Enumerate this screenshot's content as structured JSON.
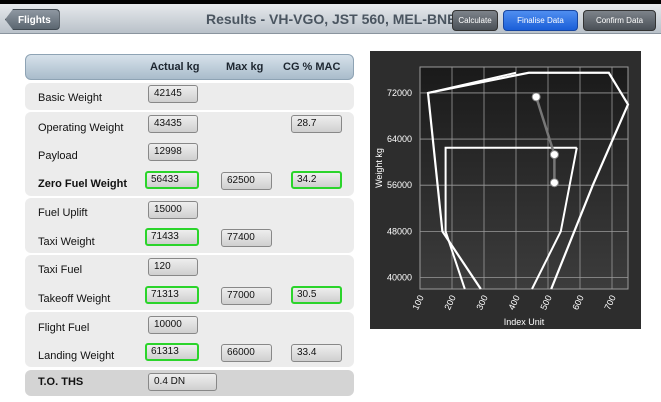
{
  "nav": {
    "back_label": "Flights",
    "title": "Results - VH-VGO, JST 560, MEL-BNE",
    "calculate_label": "Calculate",
    "finalise_label": "Finalise Data",
    "confirm_label": "Confirm Data"
  },
  "table": {
    "headers": {
      "actual": "Actual kg",
      "max": "Max kg",
      "cg": "CG % MAC"
    },
    "rows": [
      {
        "label": "Basic Weight",
        "actual": "42145"
      },
      {
        "label": "Operating Weight",
        "actual": "43435",
        "cg": "28.7"
      },
      {
        "label": "Payload",
        "actual": "12998"
      },
      {
        "label": "Zero Fuel Weight",
        "actual": "56433",
        "max": "62500",
        "cg": "34.2"
      },
      {
        "label": "Fuel Uplift",
        "actual": "15000"
      },
      {
        "label": "Taxi Weight",
        "actual": "71433",
        "max": "77400"
      },
      {
        "label": "Taxi Fuel",
        "actual": "120"
      },
      {
        "label": "Takeoff Weight",
        "actual": "71313",
        "max": "77000",
        "cg": "30.5"
      },
      {
        "label": "Flight Fuel",
        "actual": "10000"
      },
      {
        "label": "Landing Weight",
        "actual": "61313",
        "max": "66000",
        "cg": "33.4"
      }
    ],
    "ths": {
      "label": "T.O. THS",
      "value": "0.4 DN"
    }
  },
  "chart_data": {
    "type": "line",
    "xlabel": "Index Unit",
    "ylabel": "Weight kg",
    "xlim": [
      100,
      750
    ],
    "ylim": [
      38000,
      76500
    ],
    "x_ticks": [
      100,
      200,
      300,
      400,
      500,
      600,
      700
    ],
    "y_ticks": [
      40000,
      48000,
      56000,
      64000,
      72000
    ],
    "grid": true,
    "envelope_outer": [
      [
        510,
        38000
      ],
      [
        640,
        56000
      ],
      [
        750,
        70000
      ],
      [
        690,
        75500
      ],
      [
        440,
        75500
      ],
      [
        125,
        72000
      ],
      [
        155,
        56000
      ],
      [
        170,
        48000
      ],
      [
        290,
        38000
      ]
    ],
    "envelope_inner": [
      [
        240,
        38000
      ],
      [
        180,
        48000
      ],
      [
        180,
        62500
      ],
      [
        590,
        62500
      ]
    ],
    "envelope_top": [
      [
        125,
        72000
      ],
      [
        400,
        75500
      ]
    ],
    "envelope_inner_right": [
      [
        450,
        38000
      ],
      [
        540,
        48000
      ],
      [
        590,
        62500
      ]
    ],
    "trim_points": [
      [
        463,
        71313
      ],
      [
        520,
        61313
      ],
      [
        520,
        56433
      ]
    ],
    "colors": {
      "background": "#2d2d2d",
      "grid": "#9a9a9a",
      "envelope": "#ffffff",
      "trim": "#777777"
    }
  }
}
